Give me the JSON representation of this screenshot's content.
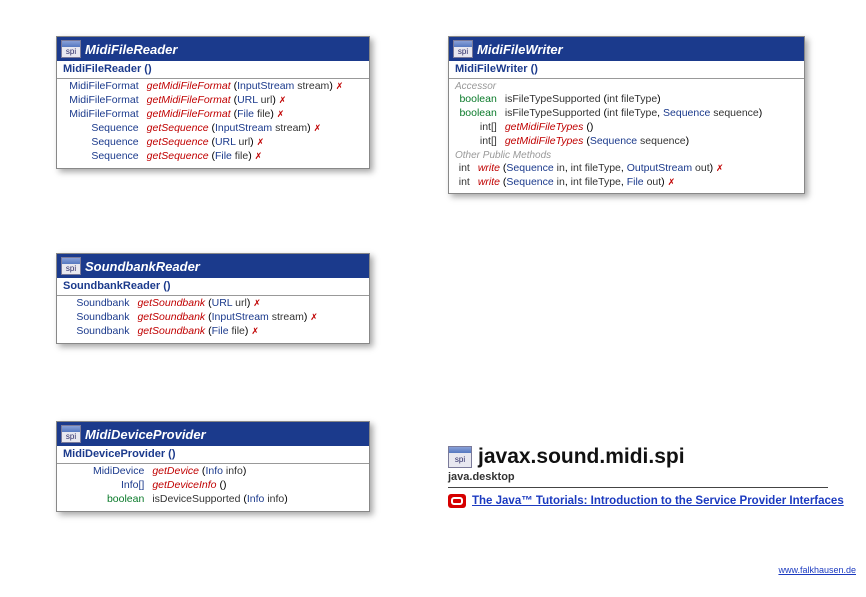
{
  "icon_label": "spi",
  "classes": {
    "midiFileReader": {
      "name": "MidiFileReader",
      "constructor": "MidiFileReader ()",
      "methods": [
        {
          "ret": "MidiFileFormat",
          "retLink": true,
          "name": "getMidiFileFormat",
          "nameItalic": true,
          "params": [
            {
              "type": "InputStream",
              "name": "stream"
            }
          ],
          "throws": true
        },
        {
          "ret": "MidiFileFormat",
          "retLink": true,
          "name": "getMidiFileFormat",
          "nameItalic": true,
          "params": [
            {
              "type": "URL",
              "name": "url"
            }
          ],
          "throws": true
        },
        {
          "ret": "MidiFileFormat",
          "retLink": true,
          "name": "getMidiFileFormat",
          "nameItalic": true,
          "params": [
            {
              "type": "File",
              "name": "file"
            }
          ],
          "throws": true
        },
        {
          "ret": "Sequence",
          "retLink": true,
          "name": "getSequence",
          "nameItalic": true,
          "params": [
            {
              "type": "InputStream",
              "name": "stream"
            }
          ],
          "throws": true
        },
        {
          "ret": "Sequence",
          "retLink": true,
          "name": "getSequence",
          "nameItalic": true,
          "params": [
            {
              "type": "URL",
              "name": "url"
            }
          ],
          "throws": true
        },
        {
          "ret": "Sequence",
          "retLink": true,
          "name": "getSequence",
          "nameItalic": true,
          "params": [
            {
              "type": "File",
              "name": "file"
            }
          ],
          "throws": true
        }
      ]
    },
    "midiFileWriter": {
      "name": "MidiFileWriter",
      "constructor": "MidiFileWriter ()",
      "sections": [
        {
          "label": "Accessor",
          "methods": [
            {
              "ret": "boolean",
              "retLink": false,
              "retColor": "#0a7a2a",
              "name": "isFileTypeSupported",
              "nameItalic": false,
              "params": [
                {
                  "type": "int",
                  "plain": true,
                  "name": "fileType"
                }
              ],
              "throws": false
            },
            {
              "ret": "boolean",
              "retLink": false,
              "retColor": "#0a7a2a",
              "name": "isFileTypeSupported",
              "nameItalic": false,
              "params": [
                {
                  "type": "int",
                  "plain": true,
                  "name": "fileType"
                },
                {
                  "type": "Sequence",
                  "name": "sequence"
                }
              ],
              "throws": false
            },
            {
              "ret": "int[]",
              "retLink": false,
              "name": "getMidiFileTypes",
              "nameItalic": true,
              "params": [],
              "throws": false
            },
            {
              "ret": "int[]",
              "retLink": false,
              "name": "getMidiFileTypes",
              "nameItalic": true,
              "params": [
                {
                  "type": "Sequence",
                  "name": "sequence"
                }
              ],
              "throws": false
            }
          ]
        },
        {
          "label": "Other Public Methods",
          "methods": [
            {
              "ret": "int",
              "retLink": false,
              "name": "write",
              "nameItalic": true,
              "params": [
                {
                  "type": "Sequence",
                  "name": "in"
                },
                {
                  "type": "int",
                  "plain": true,
                  "name": "fileType"
                },
                {
                  "type": "OutputStream",
                  "name": "out"
                }
              ],
              "throws": true
            },
            {
              "ret": "int",
              "retLink": false,
              "name": "write",
              "nameItalic": true,
              "params": [
                {
                  "type": "Sequence",
                  "name": "in"
                },
                {
                  "type": "int",
                  "plain": true,
                  "name": "fileType"
                },
                {
                  "type": "File",
                  "name": "out"
                }
              ],
              "throws": true
            }
          ]
        }
      ]
    },
    "soundbankReader": {
      "name": "SoundbankReader",
      "constructor": "SoundbankReader ()",
      "methods": [
        {
          "ret": "Soundbank",
          "retLink": true,
          "name": "getSoundbank",
          "nameItalic": true,
          "params": [
            {
              "type": "URL",
              "name": "url"
            }
          ],
          "throws": true
        },
        {
          "ret": "Soundbank",
          "retLink": true,
          "name": "getSoundbank",
          "nameItalic": true,
          "params": [
            {
              "type": "InputStream",
              "name": "stream"
            }
          ],
          "throws": true
        },
        {
          "ret": "Soundbank",
          "retLink": true,
          "name": "getSoundbank",
          "nameItalic": true,
          "params": [
            {
              "type": "File",
              "name": "file"
            }
          ],
          "throws": true
        }
      ]
    },
    "midiDeviceProvider": {
      "name": "MidiDeviceProvider",
      "constructor": "MidiDeviceProvider ()",
      "methods": [
        {
          "ret": "MidiDevice",
          "retLink": true,
          "name": "getDevice",
          "nameItalic": true,
          "params": [
            {
              "type": "Info",
              "name": "info"
            }
          ],
          "throws": false
        },
        {
          "ret": "Info[]",
          "retLink": true,
          "name": "getDeviceInfo",
          "nameItalic": true,
          "params": [],
          "throws": false
        },
        {
          "ret": "boolean",
          "retLink": false,
          "retColor": "#0a7a2a",
          "name": "isDeviceSupported",
          "nameItalic": false,
          "params": [
            {
              "type": "Info",
              "name": "info"
            }
          ],
          "throws": false
        }
      ]
    }
  },
  "package": {
    "title": "javax.sound.midi.spi",
    "module": "java.desktop",
    "link_text": "The Java™ Tutorials: Introduction to the Service Provider Interfaces"
  },
  "credit": "www.falkhausen.de"
}
